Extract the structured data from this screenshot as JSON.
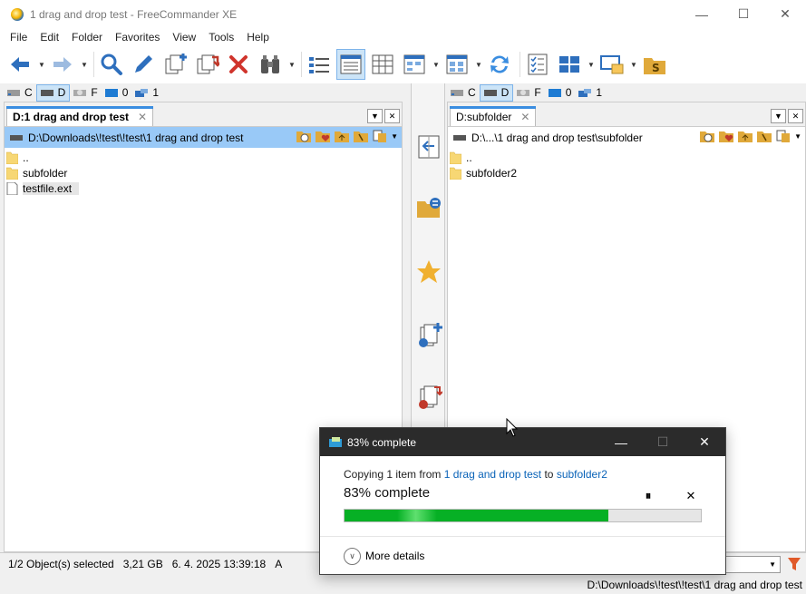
{
  "window": {
    "title": "1 drag and drop test - FreeCommander XE",
    "controls": {
      "minimize": "—",
      "maximize": "☐",
      "close": "✕"
    }
  },
  "menu": [
    "File",
    "Edit",
    "Folder",
    "Favorites",
    "View",
    "Tools",
    "Help"
  ],
  "toolbar": {
    "icons": [
      "back-arrow-icon",
      "forward-arrow-icon",
      "search-icon",
      "edit-pencil-icon",
      "copy-files-icon",
      "move-files-icon",
      "delete-icon",
      "binoculars-icon",
      "view-list-icon",
      "view-details-icon",
      "view-columns-icon",
      "view-thumbnails-icon",
      "view-preview-icon",
      "refresh-sync-icon",
      "checklist-icon",
      "layout-grid-icon",
      "monitor-icon",
      "folder-s-icon"
    ]
  },
  "drives_left": [
    {
      "label": "C",
      "selected": false
    },
    {
      "label": "D",
      "selected": true
    },
    {
      "label": "F",
      "selected": false
    },
    {
      "label": "0",
      "selected": false
    },
    {
      "label": "1",
      "selected": false
    }
  ],
  "drives_right": [
    {
      "label": "C",
      "selected": false
    },
    {
      "label": "D",
      "selected": true
    },
    {
      "label": "F",
      "selected": false
    },
    {
      "label": "0",
      "selected": false
    },
    {
      "label": "1",
      "selected": false
    }
  ],
  "left_panel": {
    "tab_label": "D:1 drag and drop test",
    "tab_close": "✕",
    "path": "D:\\Downloads\\!test\\!test\\1 drag and drop test",
    "files": [
      {
        "name": "..",
        "type": "folder"
      },
      {
        "name": "subfolder",
        "type": "folder"
      },
      {
        "name": "testfile.ext",
        "type": "file"
      }
    ]
  },
  "right_panel": {
    "tab_label": "D:subfolder",
    "tab_close": "✕",
    "path": "D:\\...\\1 drag and drop test\\subfolder",
    "files": [
      {
        "name": "..",
        "type": "folder"
      },
      {
        "name": "subfolder2",
        "type": "folder"
      }
    ]
  },
  "tab_buttons": {
    "dropdown": "▼",
    "close": "✕"
  },
  "statusbar": {
    "selection": "1/2 Object(s) selected",
    "size": "3,21 GB",
    "datetime": "6. 4. 2025 13:39:18",
    "attr": "A"
  },
  "bottom_path": "D:\\Downloads\\!test\\!test\\1 drag and drop test",
  "dialog": {
    "title": "83% complete",
    "copy_prefix": "Copying 1 item from ",
    "source": "1 drag and drop test",
    "to_word": " to ",
    "destination": "subfolder2",
    "percent_text": "83% complete",
    "progress": 0.74,
    "pause_glyph": "⏸",
    "cancel_glyph": "✕",
    "more_details": "More details",
    "controls": {
      "minimize": "—",
      "maximize": "☐",
      "close": "✕"
    }
  },
  "colors": {
    "accent": "#3a8de0",
    "path_active": "#99c9f7",
    "progress_green": "#06b025",
    "folder_yellow": "#f7d774",
    "link_blue": "#0a63b8"
  }
}
